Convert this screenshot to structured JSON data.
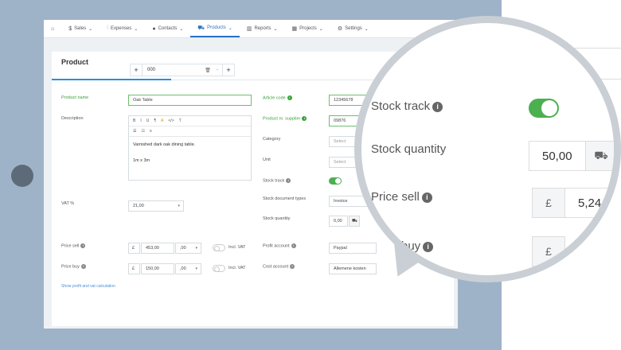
{
  "nav": {
    "items": [
      {
        "label": "Sales",
        "icon": "dollar-icon"
      },
      {
        "label": "Expenses",
        "icon": "receipt-icon"
      },
      {
        "label": "Contacts",
        "icon": "person-icon"
      },
      {
        "label": "Products",
        "icon": "cart-icon"
      },
      {
        "label": "Reports",
        "icon": "chart-icon"
      },
      {
        "label": "Projects",
        "icon": "calendar-icon"
      },
      {
        "label": "Settings",
        "icon": "gear-icon"
      }
    ],
    "active": "Products"
  },
  "product": {
    "title": "Product",
    "number": "000",
    "name_label": "Product name",
    "name_value": "Oak Table",
    "description_label": "Description",
    "description_line1": "Varnished dark oak dining table.",
    "description_line2": "1m x 3m",
    "vat_label": "VAT %",
    "vat_value": "21,00",
    "price_sell_label": "Price sell",
    "price_sell_currency": "£",
    "price_sell_value": "453,00",
    "price_sell_decimals": ",00",
    "price_buy_label": "Price buy",
    "price_buy_currency": "£",
    "price_buy_value": "150,00",
    "price_buy_decimals": ",00",
    "incl_vat_label": "Incl. VAT",
    "show_calc_link": "Show profit and vat calculation",
    "article_code_label": "Article code",
    "article_code_value": "12345678",
    "supplier_label": "Product nr. supplier",
    "supplier_value": "09876",
    "category_label": "Category",
    "category_value": "Select",
    "unit_label": "Unit",
    "unit_value": "Select",
    "stock_track_label": "Stock track",
    "stock_doc_label": "Stock document types",
    "stock_doc_value": "Invoice",
    "stock_qty_label": "Stock quantity",
    "stock_qty_value": "0,00",
    "profit_account_label": "Profit account",
    "profit_account_value": "Paypal",
    "cost_account_label": "Cost account",
    "cost_account_value": "Allemene kosten"
  },
  "magnifier": {
    "select_label": "Select",
    "stock_track_label": "Stock track",
    "stock_quantity_label": "Stock quantity",
    "stock_quantity_value": "50,00",
    "price_sell_label": "Price sell",
    "currency": "£",
    "price_sell_value": "5,24",
    "price_buy_fragment": "buy"
  },
  "colors": {
    "accent": "#2b72c4",
    "toggle_on": "#4caf50",
    "green_label": "#3aa23a"
  }
}
